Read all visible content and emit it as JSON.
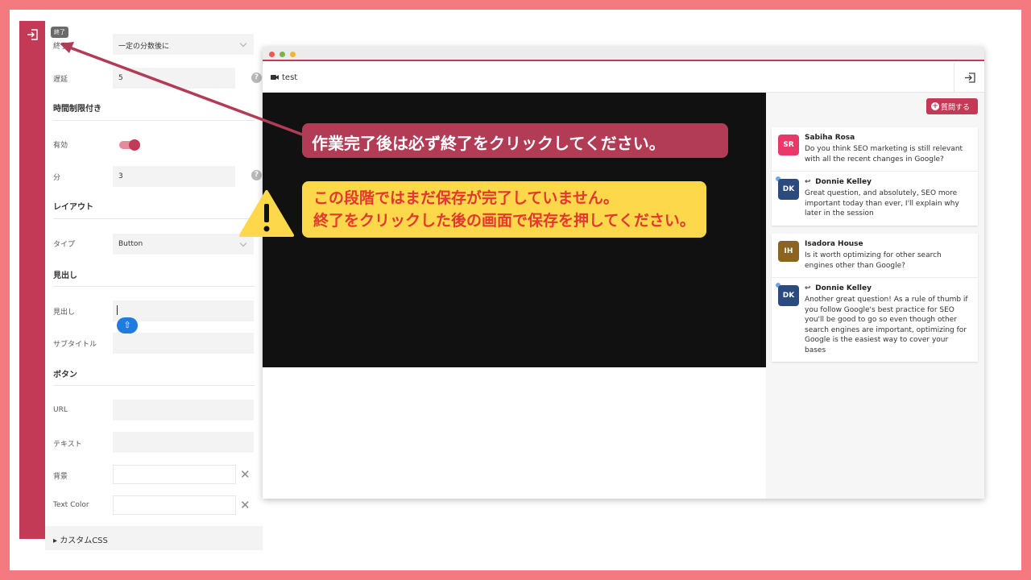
{
  "tooltip": "終了",
  "panel": {
    "rows": {
      "end_label": "終了",
      "end_value": "一定の分数後に",
      "delay_label": "遅延",
      "delay_value": "5",
      "time_limit_title": "時間制限付き",
      "enabled_label": "有効",
      "minutes_label": "分",
      "minutes_value": "3",
      "layout_title": "レイアウト",
      "type_label": "タイプ",
      "type_value": "Button",
      "heading_title": "見出し",
      "heading_label": "見出し",
      "subtitle_label": "サブタイトル",
      "button_title": "ボタン",
      "url_label": "URL",
      "text_label": "テキスト",
      "background_label": "背景",
      "text_color_label": "Text Color",
      "custom_css": "カスタムCSS"
    },
    "help_glyph": "?",
    "clear_glyph": "✕",
    "enabled": true
  },
  "browser": {
    "title": "test",
    "ask_button": "質問する",
    "messages": [
      {
        "avatar": "SR",
        "avatar_color": "#e8396a",
        "name": "Sabiha Rosa",
        "text": "Do you think SEO marketing is still relevant with all the recent changes in Google?",
        "reply": false
      },
      {
        "avatar": "DK",
        "avatar_color": "#2b4a7e",
        "name": "Donnie Kelley",
        "text": "Great question, and absolutely, SEO more important today than ever, I'll explain why later in the session",
        "reply": true
      },
      {
        "avatar": "IH",
        "avatar_color": "#8a6420",
        "name": "Isadora House",
        "text": "Is it worth optimizing for other search engines other than Google?",
        "reply": false
      },
      {
        "avatar": "DK",
        "avatar_color": "#2b4a7e",
        "name": "Donnie Kelley",
        "text": "Another great question! As a rule of thumb if you follow Google's best practice for SEO you'll be good to go so even though other search engines are important, optimizing for Google is the easiest way to cover your bases",
        "reply": true
      }
    ]
  },
  "annotations": {
    "red_note": "作業完了後は必ず終了をクリックしてください。",
    "yellow_line1": "この段階ではまだ保存が完了していません。",
    "yellow_line2": "終了をクリックした後の画面で保存を押してください。"
  },
  "colors": {
    "frame": "#f47a80",
    "accent": "#c23a56",
    "note_red": "#b23b55",
    "note_yellow": "#fdd84a",
    "note_yellow_text": "#e4372f"
  }
}
